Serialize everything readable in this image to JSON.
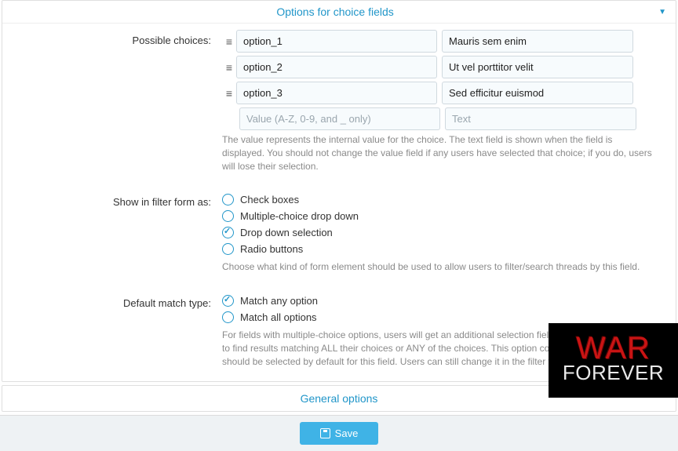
{
  "panel": {
    "title": "Options for choice fields"
  },
  "possible_choices": {
    "label": "Possible choices:",
    "rows": [
      {
        "value": "option_1",
        "text": "Mauris sem enim"
      },
      {
        "value": "option_2",
        "text": "Ut vel porttitor velit"
      },
      {
        "value": "option_3",
        "text": "Sed efficitur euismod"
      }
    ],
    "new_value_placeholder": "Value (A-Z, 0-9, and _ only)",
    "new_text_placeholder": "Text",
    "help": "The value represents the internal value for the choice. The text field is shown when the field is displayed. You should not change the value field if any users have selected that choice; if you do, users will lose their selection."
  },
  "filter_form": {
    "label": "Show in filter form as:",
    "options": [
      {
        "label": "Check boxes",
        "selected": false
      },
      {
        "label": "Multiple-choice drop down",
        "selected": false
      },
      {
        "label": "Drop down selection",
        "selected": true
      },
      {
        "label": "Radio buttons",
        "selected": false
      }
    ],
    "help": "Choose what kind of form element should be used to allow users to filter/search threads by this field."
  },
  "match_type": {
    "label": "Default match type:",
    "options": [
      {
        "label": "Match any option",
        "selected": true
      },
      {
        "label": "Match all options",
        "selected": false
      }
    ],
    "help": "For fields with multiple-choice options, users will get an additional selection field to choose, if they want to find results matching ALL their choices or ANY of the choices. This option controls which value should be selected by default for this field. Users can still change it in the filter form."
  },
  "general_options": {
    "title": "General options"
  },
  "footer": {
    "save_label": "Save"
  },
  "overlay": {
    "line1": "WAR",
    "line2": "FOREVER"
  }
}
